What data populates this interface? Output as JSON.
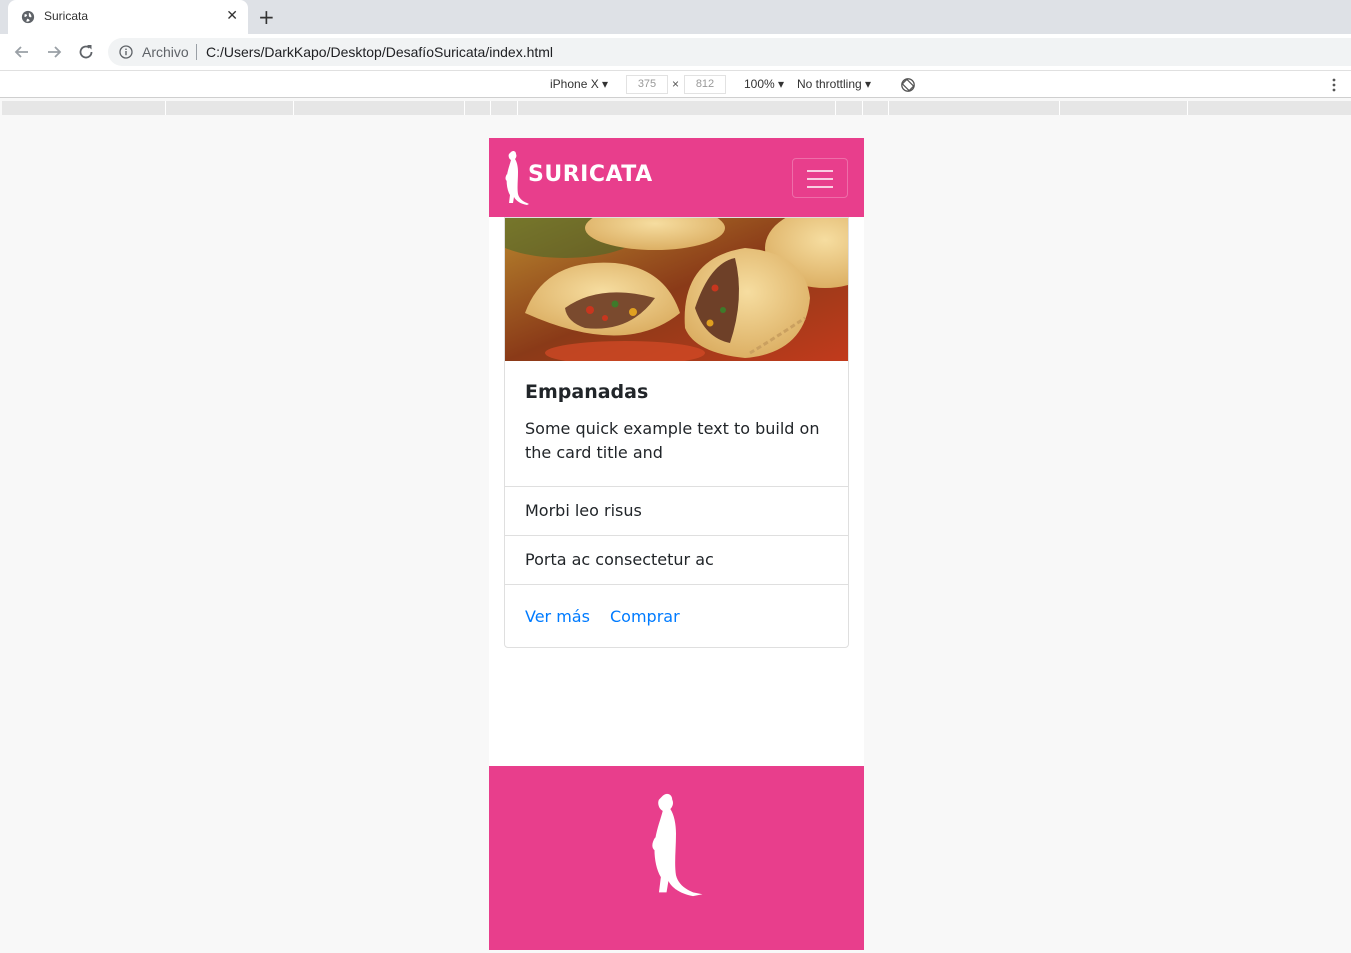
{
  "browser": {
    "tab_title": "Suricata",
    "tab_close": "✕",
    "new_tab": "+",
    "scheme_label": "Archivo",
    "url": "C:/Users/DarkKapo/Desktop/DesafíoSuricata/index.html"
  },
  "devtools": {
    "device": "iPhone X ▾",
    "width": "375",
    "times": "×",
    "height": "812",
    "zoom": "100% ▾",
    "throttling": "No throttling ▾"
  },
  "page": {
    "brand": "SURICATA",
    "card": {
      "title": "Empanadas",
      "text": "Some quick example text to build on the card title and",
      "list_items": [
        "Morbi leo risus",
        "Porta ac consectetur ac"
      ],
      "links": [
        "Ver más",
        "Comprar"
      ]
    }
  },
  "colors": {
    "brand_pink": "#e83e8c",
    "link_blue": "#007bff"
  },
  "icons": [
    "globe-icon",
    "back-icon",
    "forward-icon",
    "reload-icon",
    "info-icon",
    "rotate-icon",
    "more-vert-icon",
    "meerkat-logo",
    "hamburger-icon"
  ]
}
